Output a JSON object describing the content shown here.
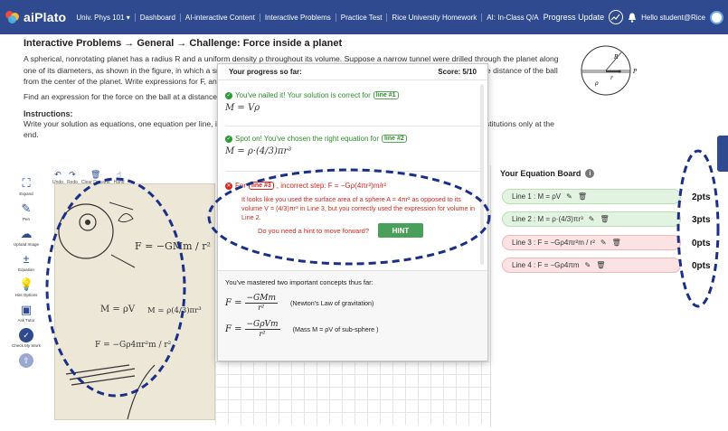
{
  "nav": {
    "brand": "aiPlato",
    "course": "Univ. Phys 101 ▾",
    "items": [
      "Dashboard",
      "AI-interactive Content",
      "Interactive Problems",
      "Practice Test",
      "Rice University Homework",
      "AI: In-Class Q/A"
    ],
    "progress_update": "Progress Update",
    "greeting": "Hello student@Rice"
  },
  "problem": {
    "breadcrumb": "Interactive Problems → General → Challenge: Force inside a planet",
    "text": "A spherical, nonrotating planet has a radius R and a uniform density ρ throughout its volume. Suppose a narrow tunnel were drilled through the planet along one of its diameters, as shown in the figure, in which a small ball of mass m could move freely under the influence of gravity. Let r be the distance of the ball from the center of the planet. Write expressions for F, and as you proceed, make substitutions in terms of known quantities.",
    "find": "Find an expression for the force on the ball at a distance r from the center of the planet.",
    "instructions_title": "Instructions:",
    "instructions": "Write your solution as equations, one equation per line, in the Equation Board. Use algebraic symbols throughout, making numeric substitutions only at the end."
  },
  "diagram": {
    "labels": [
      "R",
      "r",
      "ρ",
      "P"
    ]
  },
  "tools": [
    {
      "name": "expand",
      "label": "Expand",
      "icon": "⛶"
    },
    {
      "name": "pen",
      "label": "Pen",
      "icon": "✎"
    },
    {
      "name": "upload",
      "label": "Upload Image",
      "icon": "☁"
    },
    {
      "name": "equation",
      "label": "Equation",
      "icon": "±"
    },
    {
      "name": "hint",
      "label": "Hint Options",
      "icon": "💡"
    },
    {
      "name": "tutor",
      "label": "Ask Tutor",
      "icon": "▣"
    },
    {
      "name": "check",
      "label": "Check My Work",
      "icon": "✓"
    },
    {
      "name": "submit",
      "label": "",
      "icon": "⇧"
    }
  ],
  "canvas_toolbar": [
    {
      "label": "Undo",
      "icon": "↶"
    },
    {
      "label": "Redo",
      "icon": "↷"
    },
    {
      "label": "Clear Drawing",
      "icon": "🗑"
    },
    {
      "label": "Hand",
      "icon": "☝"
    }
  ],
  "modal": {
    "title": "Your progress so far:",
    "score": "Score: 5/10",
    "line1": {
      "msg": "You've nailed it! Your solution is correct for",
      "tag": "line #1",
      "eq": "M = Vρ"
    },
    "line2": {
      "msg": "Spot on! You've chosen the right equation for",
      "tag": "line #2",
      "eq": "M = ρ·(4/3)πr³"
    },
    "line3": {
      "prefix": "For",
      "tag": "line #3",
      "msg": ", incorrect step: F = −Gρ(4πr²)m/r²",
      "body": "It looks like you used the surface area of a sphere A = 4πr² as opposed to its volume V = (4/3)πr³ in Line 3, but you correctly used the expression for volume in Line 2."
    },
    "hint_question": "Do you need a hint to move forward?",
    "hint_button": "HINT",
    "mastered_title": "You've mastered two important concepts thus far:",
    "concepts": [
      {
        "lhs": "F =",
        "num": "−GMm",
        "den": "r²",
        "desc": "(Newton's Law of gravitation)"
      },
      {
        "lhs": "F =",
        "num": "−GρVm",
        "den": "r²",
        "desc": "(Mass M = ρV of sub-sphere )"
      }
    ]
  },
  "board": {
    "title": "Your Equation Board",
    "rows": [
      {
        "label": "Line 1 : M = ρV",
        "points": "2pts",
        "status": "correct"
      },
      {
        "label": "Line 2 : M = ρ·(4/3)πr³",
        "points": "3pts",
        "status": "correct"
      },
      {
        "label": "Line 3 : F = −Gρ4πr²m / r²",
        "points": "0pts",
        "status": "incorrect"
      },
      {
        "label": "Line 4 : F = −Gρ4πm",
        "points": "0pts",
        "status": "incorrect"
      }
    ]
  },
  "handwriting": {
    "lines": [
      "F = −GMm / r²",
      "M = ρV",
      "M = ρ(4/3)πr³",
      "F = −Gρ4πr²m / r²"
    ]
  },
  "colors": {
    "nav": "#2f4a8f",
    "correct": "#2e9a3a",
    "incorrect": "#d7261e",
    "annotation": "#1b2f86"
  }
}
